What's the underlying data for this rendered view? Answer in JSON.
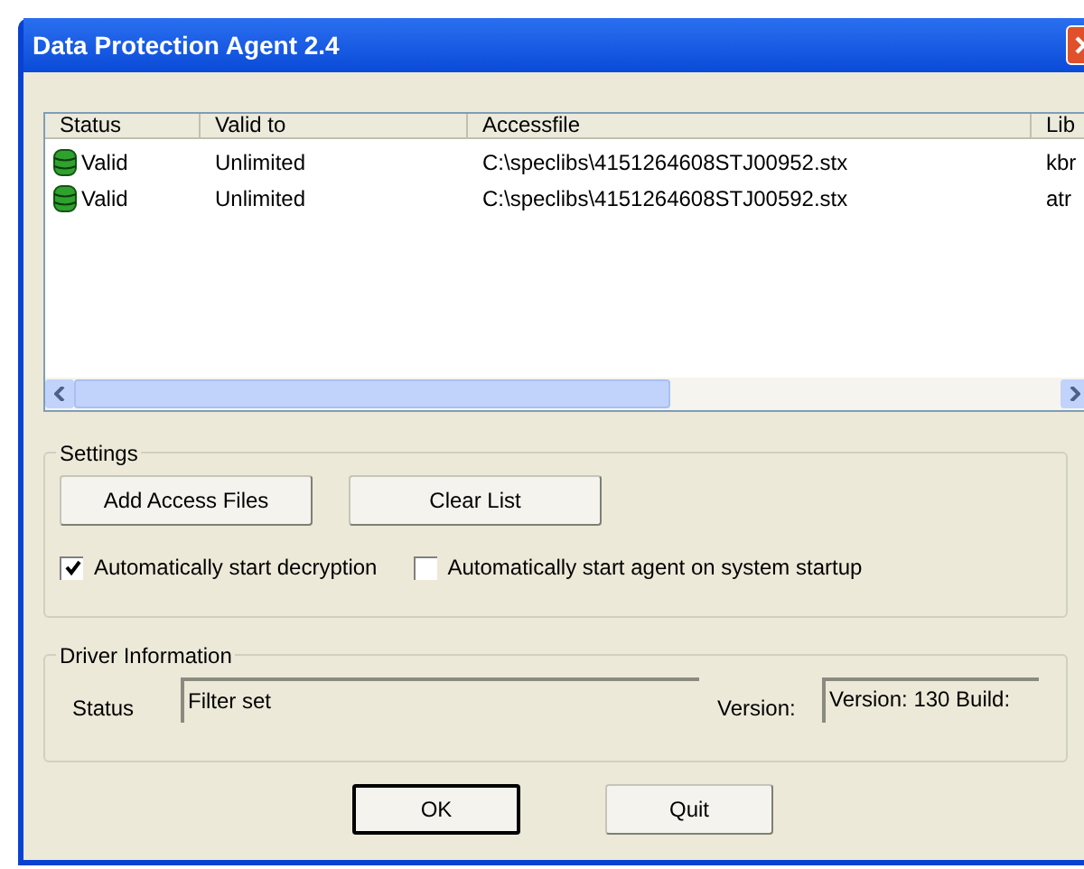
{
  "window": {
    "title": "Data Protection Agent 2.4"
  },
  "table": {
    "columns": [
      "Status",
      "Valid to",
      "Accessfile",
      "Lib"
    ],
    "rows": [
      {
        "status": "Valid",
        "valid_to": "Unlimited",
        "accessfile": "C:\\speclibs\\4151264608STJ00952.stx",
        "lib": "kbr"
      },
      {
        "status": "Valid",
        "valid_to": "Unlimited",
        "accessfile": "C:\\speclibs\\4151264608STJ00592.stx",
        "lib": "atr"
      }
    ]
  },
  "settings": {
    "title": "Settings",
    "buttons": [
      "Add Access Files",
      "Clear List"
    ],
    "checkboxes": [
      {
        "label": "Automatically start decryption",
        "checked": true
      },
      {
        "label": "Automatically start agent on system startup",
        "checked": false
      }
    ]
  },
  "driver_information": {
    "title": "Driver Information",
    "status_label": "Status",
    "status_value": "Filter set",
    "version_label": "Version:",
    "version_value": "Version: 130 Build:"
  },
  "buttons": [
    {
      "label": "OK",
      "default": true
    },
    {
      "label": "Quit",
      "default": false
    }
  ]
}
